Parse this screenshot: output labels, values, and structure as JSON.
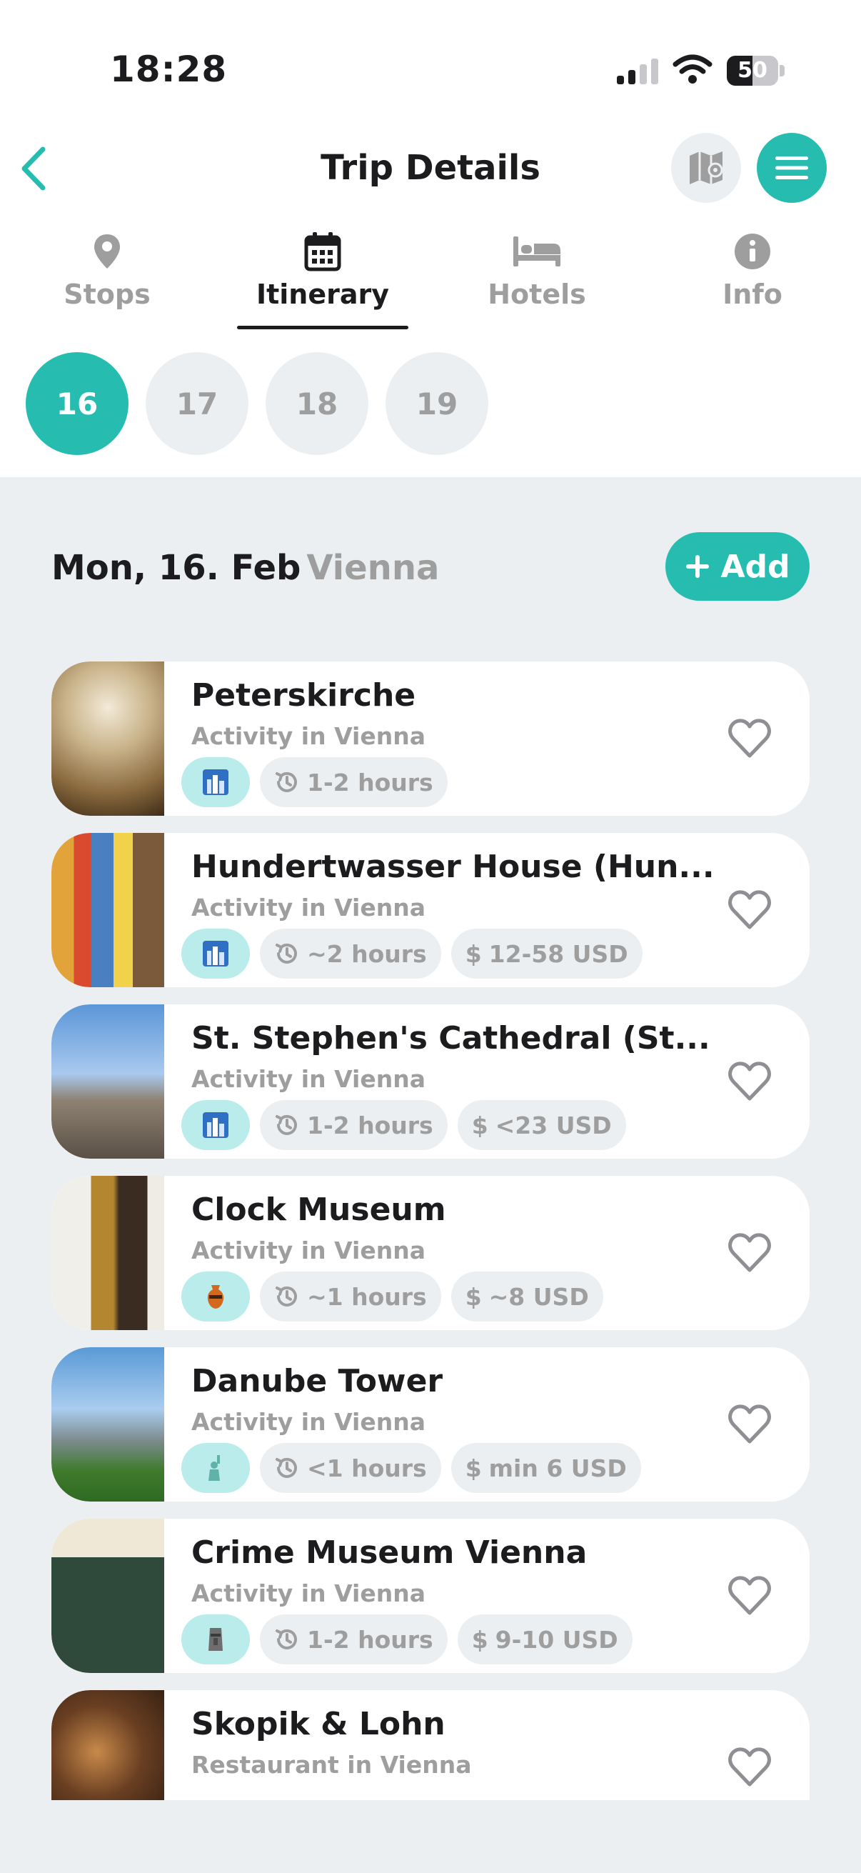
{
  "status": {
    "time": "18:28",
    "battery": "50",
    "battery_level": 0.5
  },
  "nav": {
    "title": "Trip Details"
  },
  "tabs": [
    {
      "label": "Stops",
      "icon": "map-pin-icon"
    },
    {
      "label": "Itinerary",
      "icon": "calendar-icon"
    },
    {
      "label": "Hotels",
      "icon": "bed-icon"
    },
    {
      "label": "Info",
      "icon": "info-icon"
    }
  ],
  "days": [
    "16",
    "17",
    "18",
    "19"
  ],
  "selected_day": "16",
  "day_header": {
    "date": "Mon, 16. Feb",
    "city": "Vienna",
    "add_label": "Add"
  },
  "colors": {
    "accent": "#26bdb0",
    "category_bg": "#b9ecea",
    "pill_bg": "#eceff1"
  },
  "items": [
    {
      "name": "Peterskirche",
      "subtitle": "Activity in Vienna",
      "category_icon": "cityscape-icon",
      "duration": "1-2 hours",
      "price": ""
    },
    {
      "name": "Hundertwasser House (Hun...",
      "subtitle": "Activity in Vienna",
      "category_icon": "cityscape-icon",
      "duration": "~2 hours",
      "price": "12-58 USD"
    },
    {
      "name": "St. Stephen's Cathedral (St...",
      "subtitle": "Activity in Vienna",
      "category_icon": "cityscape-icon",
      "duration": "1-2 hours",
      "price": "<23 USD"
    },
    {
      "name": "Clock Museum",
      "subtitle": "Activity in Vienna",
      "category_icon": "amphora-icon",
      "duration": "~1 hours",
      "price": "~8 USD"
    },
    {
      "name": "Danube Tower",
      "subtitle": "Activity in Vienna",
      "category_icon": "statue-of-liberty-icon",
      "duration": "<1 hours",
      "price": "min 6 USD"
    },
    {
      "name": "Crime Museum Vienna",
      "subtitle": "Activity in Vienna",
      "category_icon": "moai-icon",
      "duration": "1-2 hours",
      "price": "9-10 USD"
    },
    {
      "name": "Skopik & Lohn",
      "subtitle": "Restaurant in Vienna",
      "category_icon": "",
      "duration": "",
      "price": ""
    }
  ]
}
